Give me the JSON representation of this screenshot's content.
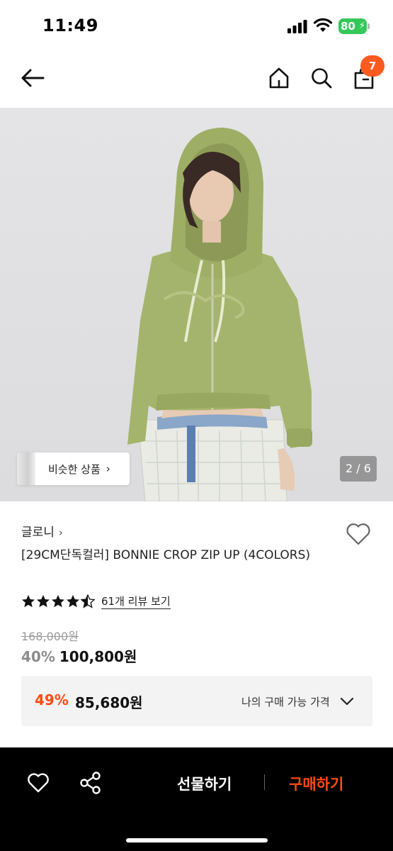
{
  "status_bar": {
    "time": "11:49",
    "battery": "80"
  },
  "header": {
    "cart_count": "7"
  },
  "gallery": {
    "similar_label": "비슷한 상품",
    "page_indicator": "2 / 6"
  },
  "product": {
    "brand": "글로니",
    "title": "[29CM단독컬러] BONNIE CROP ZIP UP (4COLORS)",
    "rating": 4.5,
    "review_link": "61개 리뷰 보기",
    "price_original": "168,000원",
    "discount": "40%",
    "price_sale": "100,800원"
  },
  "my_price": {
    "discount": "49%",
    "value": "85,680원",
    "label": "나의 구매 가능 가격"
  },
  "bottom_bar": {
    "gift_label": "선물하기",
    "buy_label": "구매하기"
  },
  "colors": {
    "accent": "#ff4b12",
    "badge": "#ff5a1f",
    "battery": "#34c759",
    "bar": "#000000"
  }
}
